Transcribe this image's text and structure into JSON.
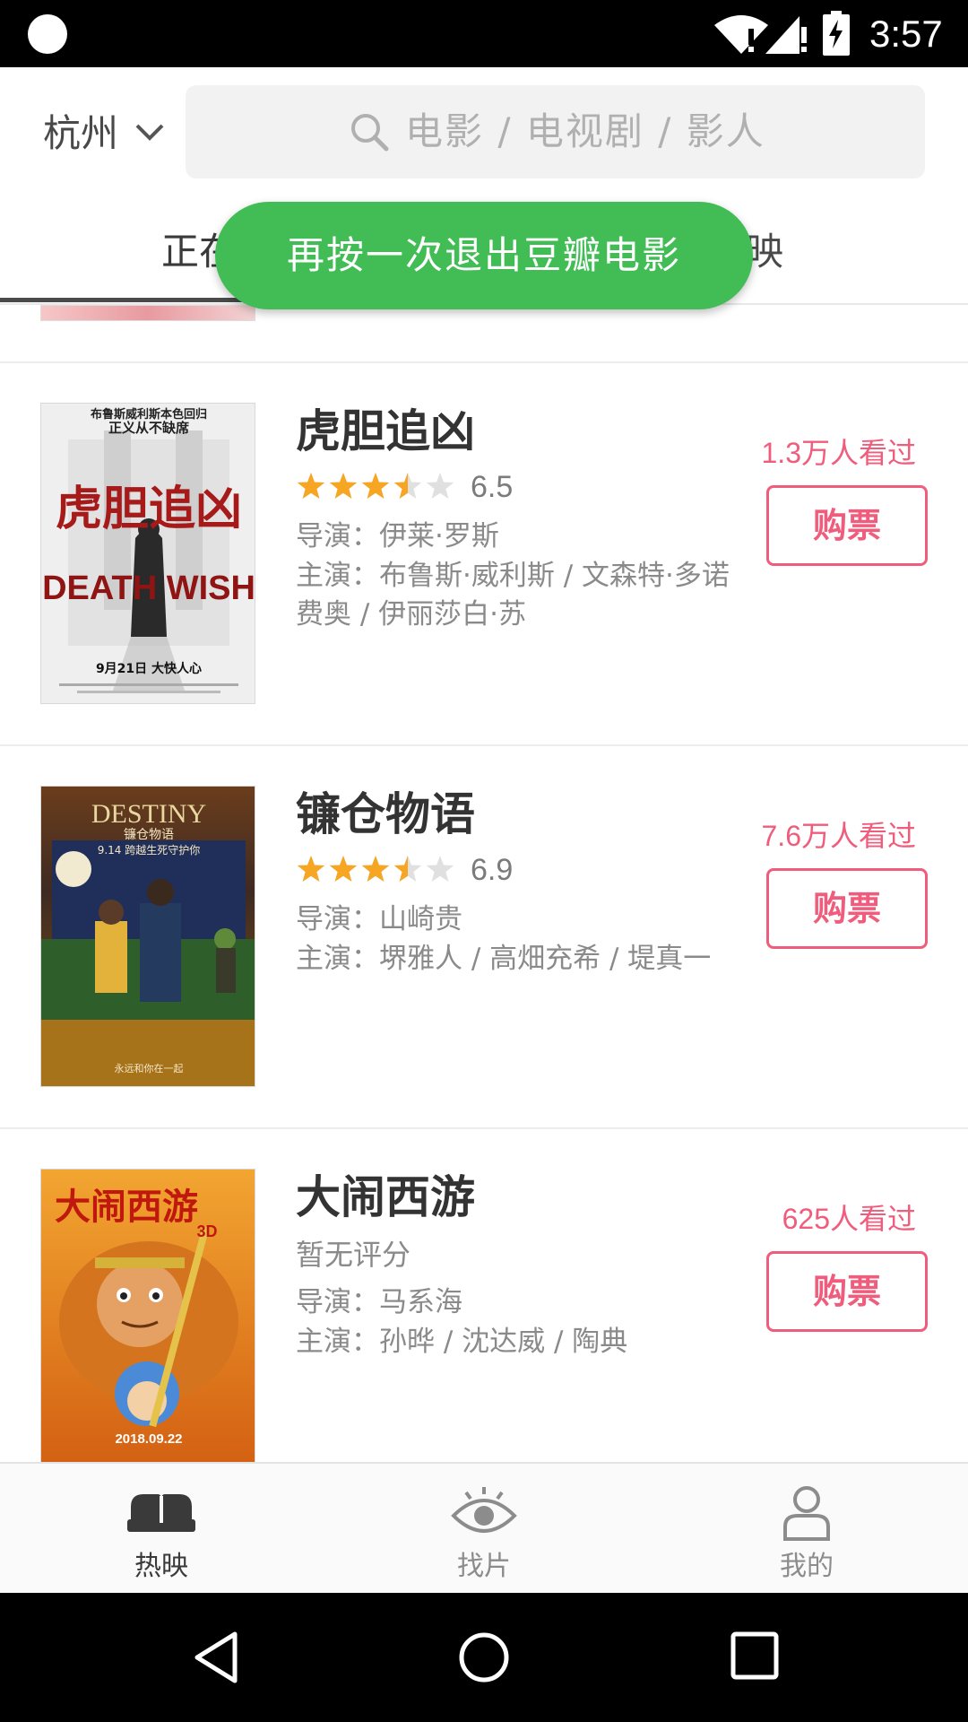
{
  "status_bar": {
    "time": "3:57"
  },
  "header": {
    "city": "杭州",
    "search_placeholder": "电影 / 电视剧 / 影人"
  },
  "tabs": {
    "now_playing": "正在",
    "upcoming": "上映"
  },
  "toast": "再按一次退出豆瓣电影",
  "movies": [
    {
      "title": "虎胆追凶",
      "rating": "6.5",
      "stars": 3.5,
      "director": "导演：伊莱·罗斯",
      "cast": "主演：布鲁斯·威利斯 / 文森特·多诺费奥 / 伊丽莎白·苏",
      "watched": "1.3万人看过",
      "buy_label": "购票",
      "poster": {
        "top_text": "布鲁斯威利斯本色回归",
        "top_text2": "正义从不缺席",
        "cn_title": "虎胆追凶",
        "en_title": "DEATH WISH",
        "date_text": "9月21日 大快人心"
      }
    },
    {
      "title": "镰仓物语",
      "rating": "6.9",
      "stars": 3.5,
      "director": "导演：山崎贵",
      "cast": "主演：堺雅人 / 高畑充希 / 堤真一",
      "watched": "7.6万人看过",
      "buy_label": "购票",
      "poster": {
        "en_title": "DESTINY",
        "cn_title": "镰仓物语",
        "tagline": "9.14 跨越生死守护你",
        "bottom_text": "永远和你在一起"
      }
    },
    {
      "title": "大闹西游",
      "no_rating": "暂无评分",
      "director": "导演：马系海",
      "cast": "主演：孙晔 / 沈达威 / 陶典",
      "watched": "625人看过",
      "buy_label": "购票",
      "poster": {
        "cn_title": "大闹西游",
        "tag_3d": "3D",
        "date_text": "2018.09.22"
      }
    }
  ],
  "bottom_nav": [
    {
      "label": "热映",
      "icon": "sofa-icon",
      "active": true
    },
    {
      "label": "找片",
      "icon": "eye-icon",
      "active": false
    },
    {
      "label": "我的",
      "icon": "person-icon",
      "active": false
    }
  ],
  "colors": {
    "accent_pink": "#f05c7b",
    "toast_green": "#42bd56",
    "star_gold": "#f6a623"
  }
}
